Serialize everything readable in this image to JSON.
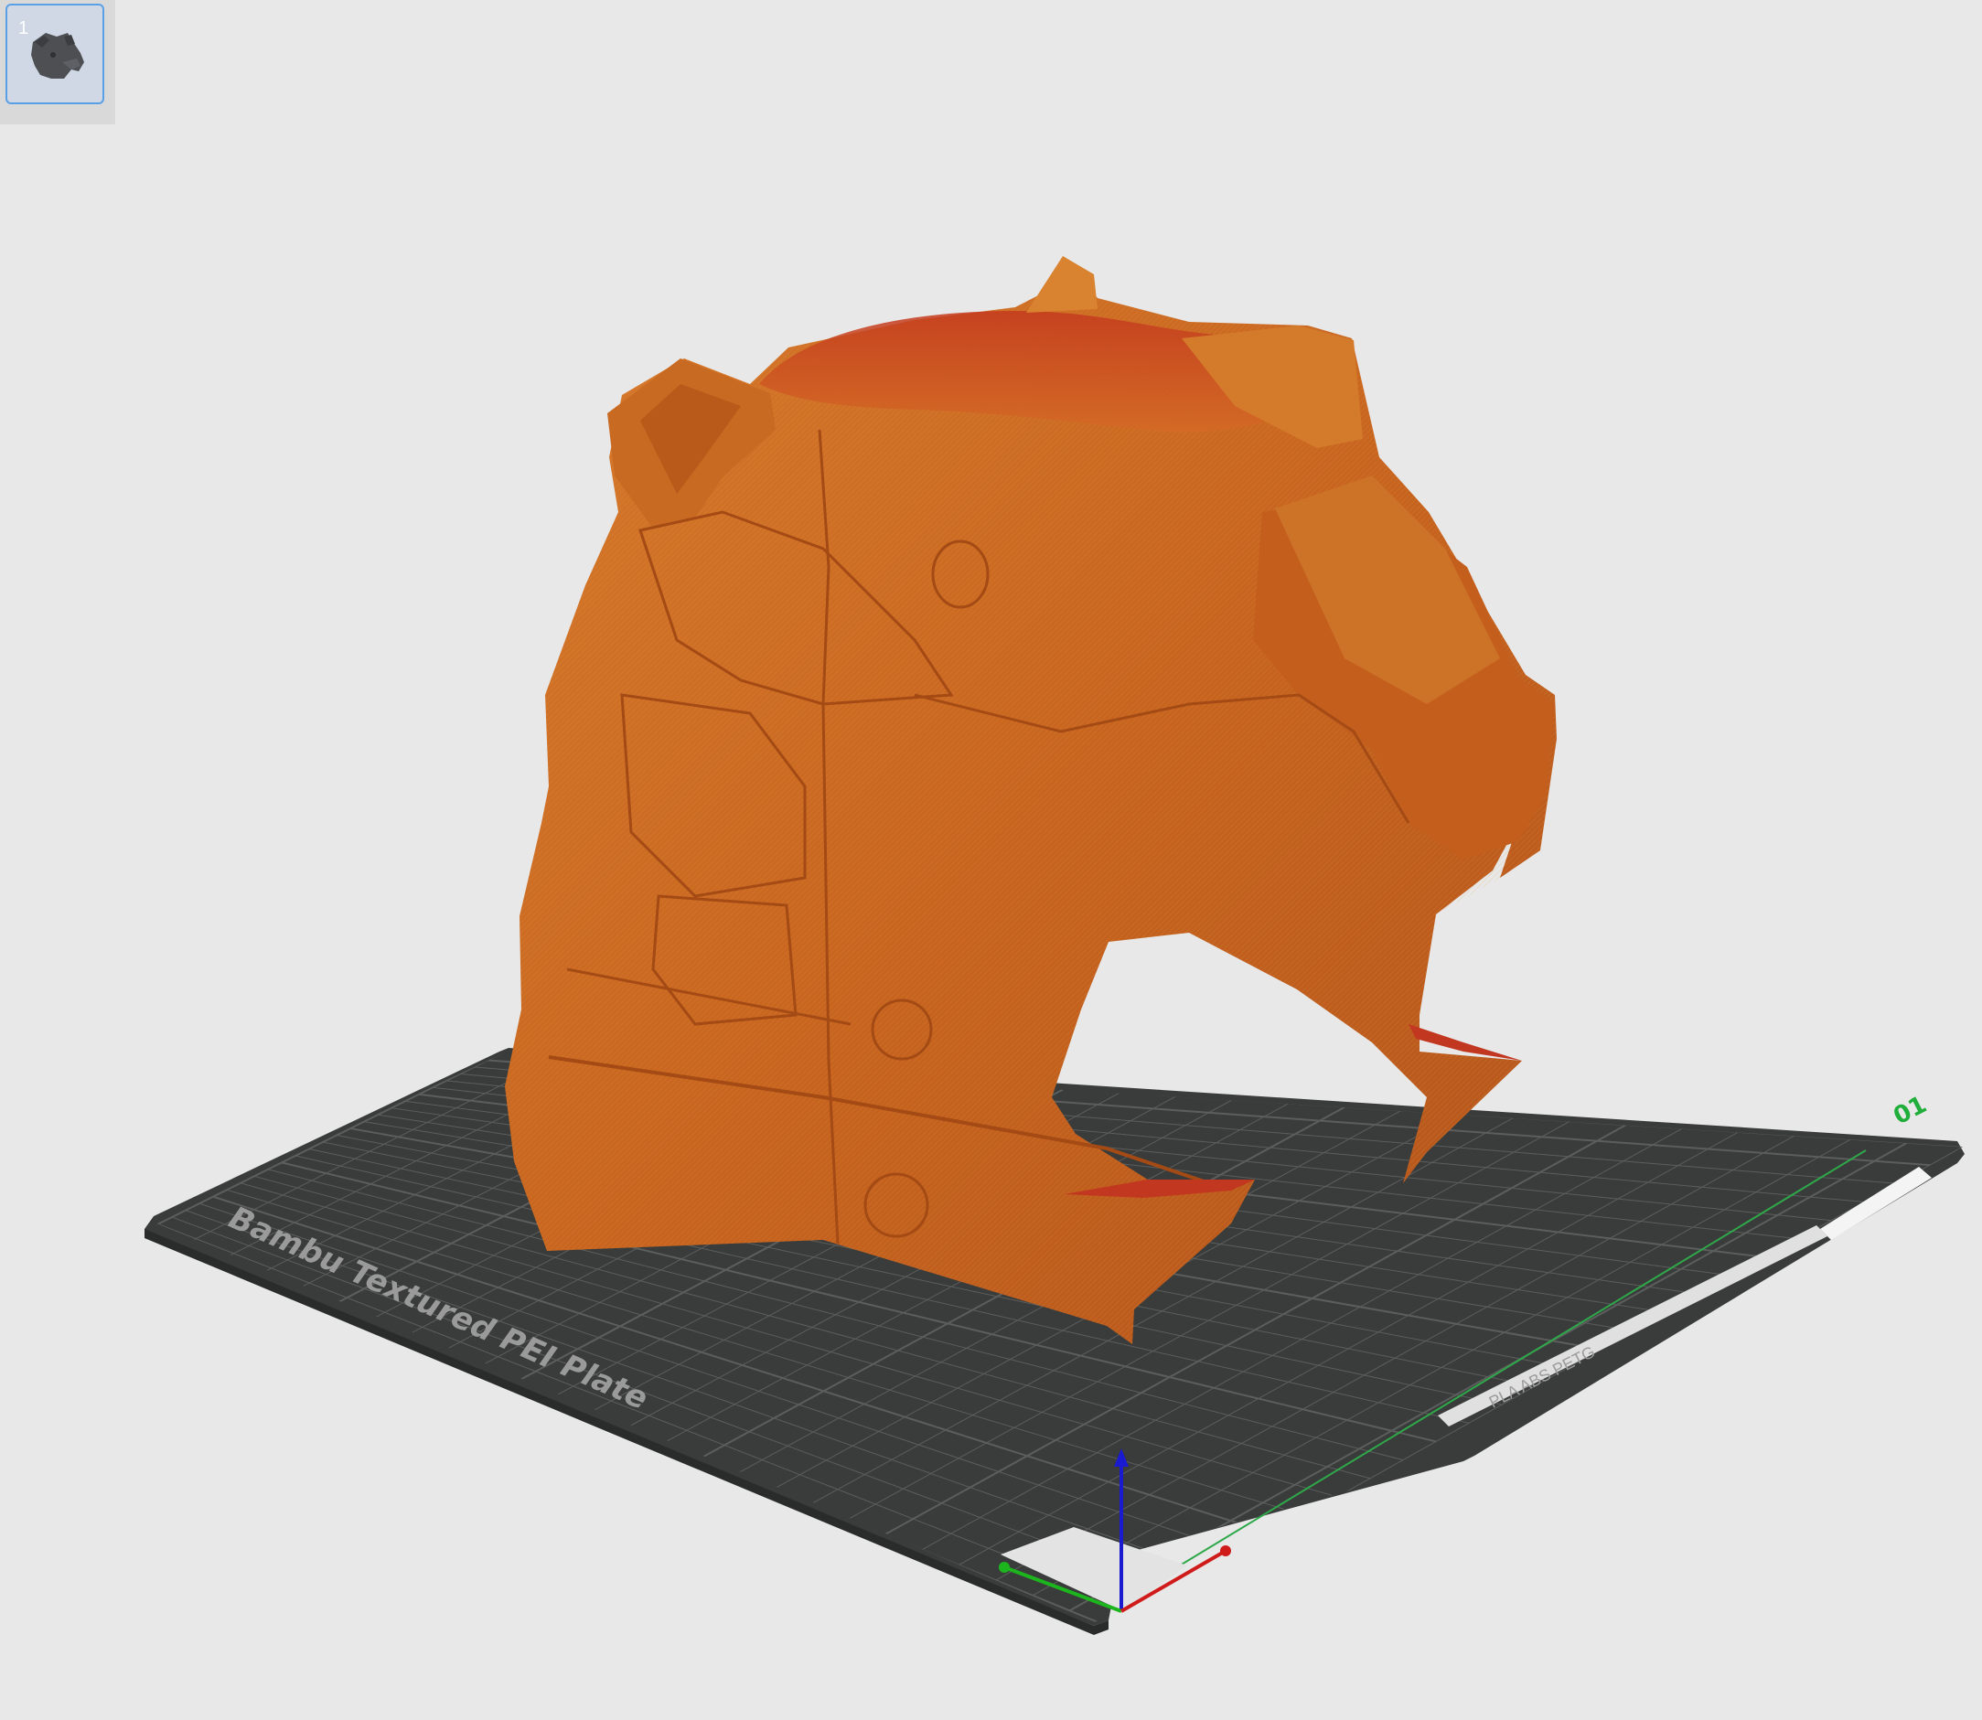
{
  "plate_list": {
    "items": [
      {
        "number": "1",
        "selected": true
      }
    ]
  },
  "build_plate": {
    "name": "Bambu Textured PEI Plate",
    "label_text": "PLA ABS PETG",
    "plate_number": "01"
  },
  "model": {
    "icon": "bear-head-helmet",
    "color": "#c8641f"
  },
  "axes": {
    "x_color": "#d01b1b",
    "y_color": "#1db51d",
    "z_color": "#1a1ad0"
  },
  "colors": {
    "background": "#e8e8e8",
    "plate": "#3a3c3b",
    "grid_line": "#5b5e5c",
    "selection": "#5aa0e6"
  }
}
